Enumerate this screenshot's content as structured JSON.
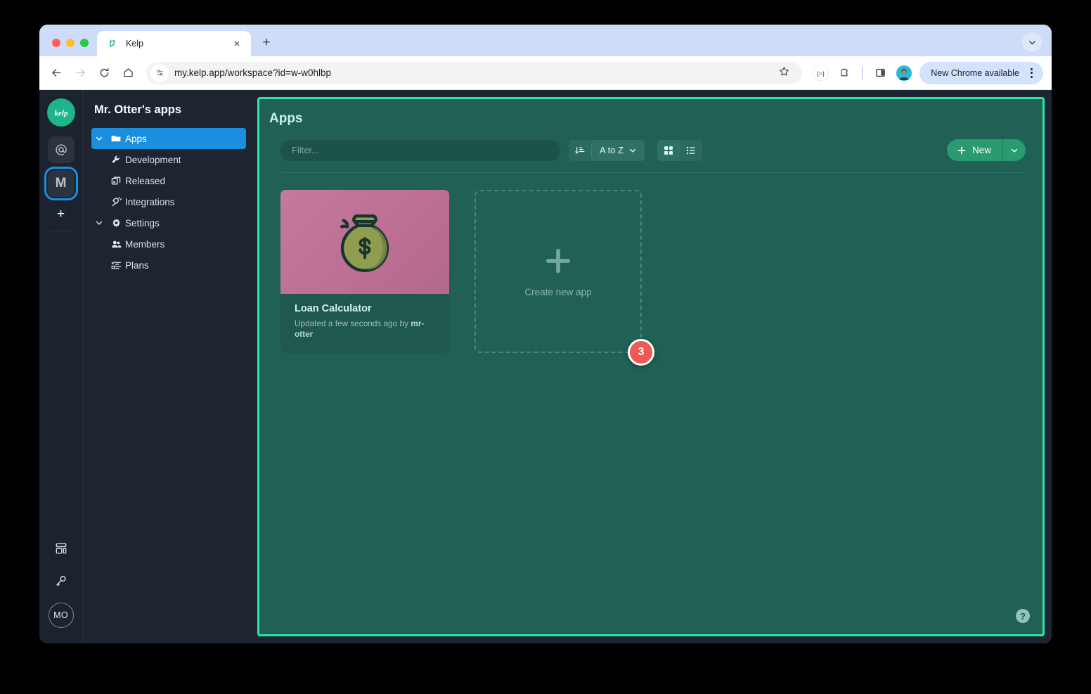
{
  "browser": {
    "tab": {
      "title": "Kelp",
      "favicon": "kelp-logo-icon",
      "close": "×"
    },
    "new_tab_label": "+",
    "tabstrip_chevron": "chevron-down-icon",
    "nav": {
      "back": "back-arrow-icon",
      "forward": "forward-arrow-icon",
      "reload": "reload-icon",
      "home": "home-icon"
    },
    "omnibox": {
      "url": "my.kelp.app/workspace?id=w-w0hlbp",
      "site_info_icon": "site-settings-icon",
      "bookmark_icon": "star-icon"
    },
    "actions": {
      "extensions_badge_icon": "equals-badge-icon",
      "extensions_icon": "puzzle-piece-icon",
      "side_panel_icon": "side-panel-icon",
      "profile_icon": "profile-avatar-icon",
      "update_label": "New Chrome available",
      "menu_icon": "three-dot-menu-icon"
    }
  },
  "rail": {
    "logo": {
      "name": "kelp-logo",
      "text": "kelp"
    },
    "items": [
      {
        "name": "workspace-at",
        "label": "@",
        "selected": false
      },
      {
        "name": "workspace-m",
        "label": "M",
        "selected": true
      }
    ],
    "add_label": "+",
    "bottom": [
      {
        "name": "templates-icon"
      },
      {
        "name": "key-icon"
      }
    ],
    "avatar": "MO"
  },
  "sidebar": {
    "title": "Mr. Otter's apps",
    "items": [
      {
        "label": "Apps",
        "icon": "folder-icon",
        "caret": "chevron-down-icon",
        "active": true,
        "level": 0
      },
      {
        "label": "Development",
        "icon": "wrench-icon",
        "caret": "",
        "active": false,
        "level": 1
      },
      {
        "label": "Released",
        "icon": "copy-icon",
        "caret": "",
        "active": false,
        "level": 1
      },
      {
        "label": "Integrations",
        "icon": "plug-icon",
        "caret": "",
        "active": false,
        "level": 0
      },
      {
        "label": "Settings",
        "icon": "gear-icon",
        "caret": "chevron-down-icon",
        "active": false,
        "level": 0
      },
      {
        "label": "Members",
        "icon": "people-icon",
        "caret": "",
        "active": false,
        "level": 1
      },
      {
        "label": "Plans",
        "icon": "list-check-icon",
        "caret": "",
        "active": false,
        "level": 1
      }
    ]
  },
  "main": {
    "title": "Apps",
    "filter_placeholder": "Filter...",
    "filter_value": "",
    "sort": {
      "icon": "sort-ascending-icon",
      "label": "A to Z",
      "caret": "chevron-down-icon"
    },
    "view": {
      "grid_icon": "grid-view-icon",
      "list_icon": "list-view-icon",
      "active": "grid"
    },
    "new_button": {
      "label": "New",
      "plus": "plus-icon",
      "caret": "chevron-down-icon"
    },
    "apps": [
      {
        "name": "Loan Calculator",
        "meta_prefix": "Updated a few seconds ago by ",
        "meta_author": "mr-otter",
        "art_icon": "money-bag-icon"
      }
    ],
    "create_card": {
      "label": "Create new app",
      "plus": "plus-icon"
    },
    "badge": "3",
    "help": "?"
  },
  "colors": {
    "accent_border": "#2ae6a4",
    "panel_bg": "#206055",
    "sidebar_active": "#1a8fe0",
    "new_button": "#2a9a70",
    "badge_red": "#ee5a52",
    "card_art": "#c4799c"
  }
}
